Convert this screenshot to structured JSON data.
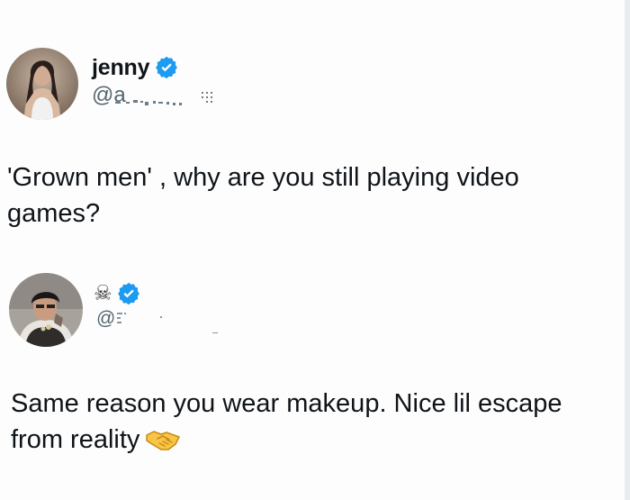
{
  "post_1": {
    "author": {
      "display_name": "jenny",
      "handle": "@a",
      "verified": true,
      "avatar_icon": "user-avatar-icon"
    },
    "text": "'Grown men' , why are you still playing video games?"
  },
  "post_2": {
    "author": {
      "display_name": "☠",
      "handle": "@",
      "verified": true,
      "avatar_icon": "user-avatar-icon"
    },
    "text": "Same reason you wear makeup. Nice lil escape from reality",
    "emoji": "handshake-icon"
  },
  "colors": {
    "verified_blue": "#1d9bf0",
    "text_primary": "#0f1419",
    "text_secondary": "#536471",
    "background": "#ffffff"
  }
}
